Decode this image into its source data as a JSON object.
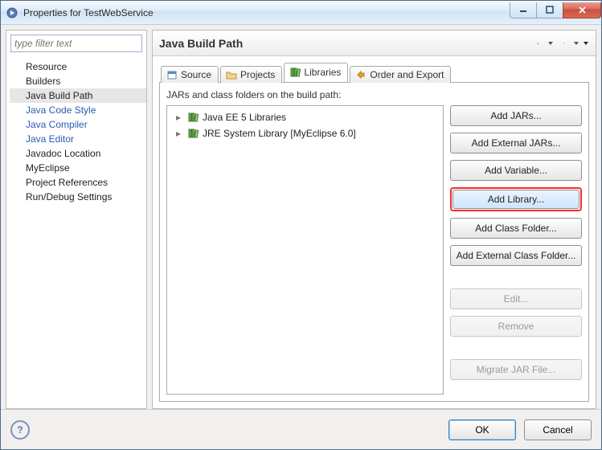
{
  "title": "Properties for TestWebService",
  "filter_placeholder": "type filter text",
  "tree": {
    "items": [
      "Resource",
      "Builders",
      "Java Build Path",
      "Java Code Style",
      "Java Compiler",
      "Java Editor",
      "Javadoc Location",
      "MyEclipse",
      "Project References",
      "Run/Debug Settings"
    ],
    "selected_index": 2,
    "accent_indices": [
      3,
      4,
      5
    ]
  },
  "panel": {
    "heading": "Java Build Path"
  },
  "tabs": [
    {
      "label": "Source",
      "icon": "source-icon"
    },
    {
      "label": "Projects",
      "icon": "projects-icon"
    },
    {
      "label": "Libraries",
      "icon": "libraries-icon"
    },
    {
      "label": "Order and Export",
      "icon": "order-icon"
    }
  ],
  "active_tab_index": 2,
  "libraries": {
    "description": "JARs and class folders on the build path:",
    "items": [
      {
        "label": "Java EE 5 Libraries"
      },
      {
        "label": "JRE System Library [MyEclipse 6.0]"
      }
    ]
  },
  "buttons": {
    "add_jars": "Add JARs...",
    "add_external_jars": "Add External JARs...",
    "add_variable": "Add Variable...",
    "add_library": "Add Library...",
    "add_class_folder": "Add Class Folder...",
    "add_external_class_folder": "Add External Class Folder...",
    "edit": "Edit...",
    "remove": "Remove",
    "migrate": "Migrate JAR File..."
  },
  "footer": {
    "ok": "OK",
    "cancel": "Cancel"
  }
}
